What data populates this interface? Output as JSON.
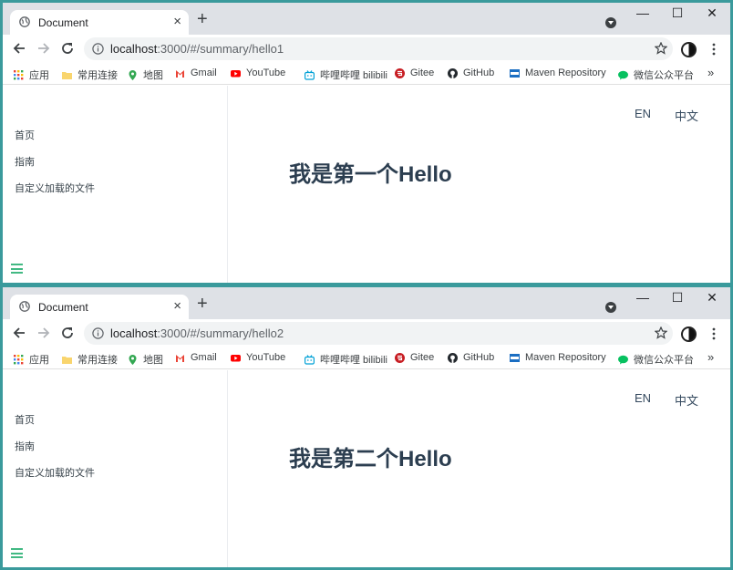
{
  "windows": [
    {
      "tab_title": "Document",
      "url_host": "localhost",
      "url_rest": ":3000/#/summary/hello1",
      "heading": "我是第一个Hello"
    },
    {
      "tab_title": "Document",
      "url_host": "localhost",
      "url_rest": ":3000/#/summary/hello2",
      "heading": "我是第二个Hello"
    }
  ],
  "window_controls": {
    "minimize": "—",
    "maximize": "☐",
    "close": "✕"
  },
  "bookmarks": [
    {
      "label": "应用",
      "icon": "apps-grid-icon",
      "color": "#4285f4"
    },
    {
      "label": "常用连接",
      "icon": "folder-icon",
      "color": "#f9d56e"
    },
    {
      "label": "地图",
      "icon": "maps-pin-icon",
      "color": "#34a853"
    },
    {
      "label": "Gmail",
      "icon": "gmail-icon",
      "color": "#ea4335"
    },
    {
      "label": "YouTube",
      "icon": "youtube-icon",
      "color": "#ff0000"
    },
    {
      "label": "哔哩哔哩 bilibili",
      "icon": "bilibili-icon",
      "color": "#00a1d6"
    },
    {
      "label": "Gitee",
      "icon": "gitee-icon",
      "color": "#c71d23"
    },
    {
      "label": "GitHub",
      "icon": "github-icon",
      "color": "#24292e"
    },
    {
      "label": "Maven Repository",
      "icon": "maven-icon",
      "color": "#1b6ec2"
    },
    {
      "label": "微信公众平台",
      "icon": "wechat-icon",
      "color": "#07c160"
    }
  ],
  "bookmarks_more": "»",
  "sidebar": {
    "links": [
      "首页",
      "指南",
      "自定义加载的文件"
    ]
  },
  "lang": {
    "en": "EN",
    "zh": "中文"
  },
  "colors": {
    "accent": "#42b983",
    "heading": "#2c3e50",
    "frame": "#3a9a9c"
  }
}
